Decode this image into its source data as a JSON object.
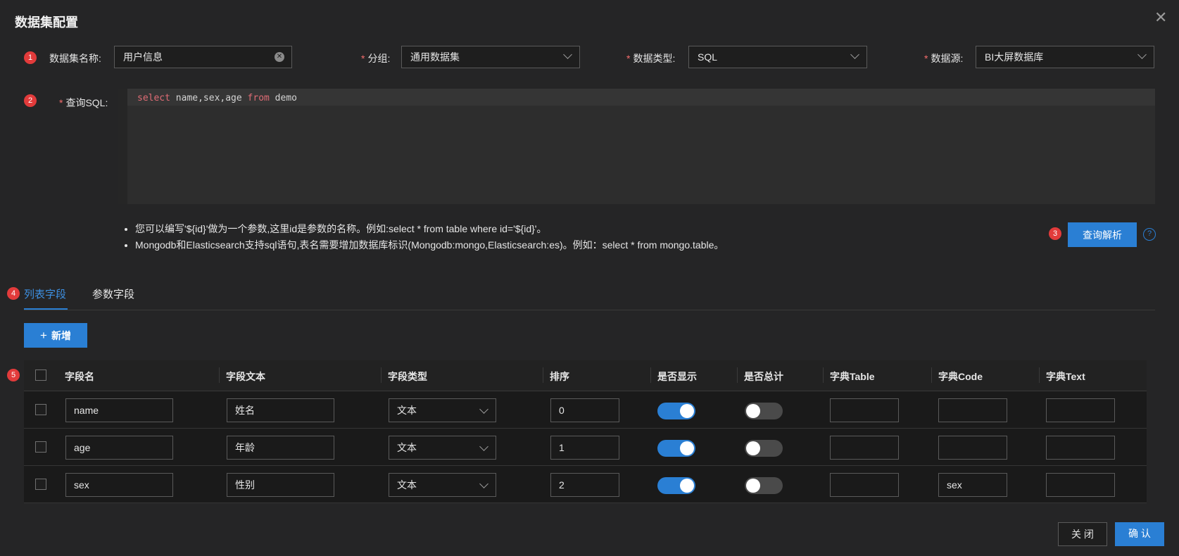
{
  "dialog": {
    "title": "数据集配置",
    "close_glyph": "✕"
  },
  "markers": [
    "1",
    "2",
    "3",
    "4",
    "5"
  ],
  "form": {
    "name_label": "数据集名称:",
    "name_value": "用户信息",
    "group_label": "分组:",
    "group_value": "通用数据集",
    "type_label": "数据类型:",
    "type_value": "SQL",
    "source_label": "数据源:",
    "source_value": "BI大屏数据库",
    "sql_label": "查询SQL:",
    "required_mark": "*"
  },
  "sql": {
    "kw_select": "select",
    "fields": " name,sex,age ",
    "kw_from": "from",
    "table": " demo"
  },
  "hints": [
    "您可以编写'${id}'做为一个参数,这里id是参数的名称。例如:select * from table where id='${id}'。",
    "Mongodb和Elasticsearch支持sql语句,表名需要增加数据库标识(Mongodb:mongo,Elasticsearch:es)。例如：select * from mongo.table。"
  ],
  "parse_button": "查询解析",
  "help_glyph": "?",
  "tabs": [
    {
      "label": "列表字段",
      "active": true
    },
    {
      "label": "参数字段",
      "active": false
    }
  ],
  "add_button": {
    "icon": "plus-icon",
    "glyph": "+",
    "label": "新增"
  },
  "table": {
    "columns": [
      "字段名",
      "字段文本",
      "字段类型",
      "排序",
      "是否显示",
      "是否总计",
      "字典Table",
      "字典Code",
      "字典Text"
    ],
    "rows": [
      {
        "field": "name",
        "text": "姓名",
        "type": "文本",
        "order": "0",
        "show": true,
        "total": false,
        "dict_table": "",
        "dict_code": "",
        "dict_text": ""
      },
      {
        "field": "age",
        "text": "年龄",
        "type": "文本",
        "order": "1",
        "show": true,
        "total": false,
        "dict_table": "",
        "dict_code": "",
        "dict_text": ""
      },
      {
        "field": "sex",
        "text": "性别",
        "type": "文本",
        "order": "2",
        "show": true,
        "total": false,
        "dict_table": "",
        "dict_code": "sex",
        "dict_text": ""
      }
    ]
  },
  "footer": {
    "close": "关 闭",
    "confirm": "确 认"
  },
  "colors": {
    "accent": "#2a7fd4",
    "badge": "#e23b3b",
    "required": "#f56c6c",
    "background": "#252526"
  }
}
